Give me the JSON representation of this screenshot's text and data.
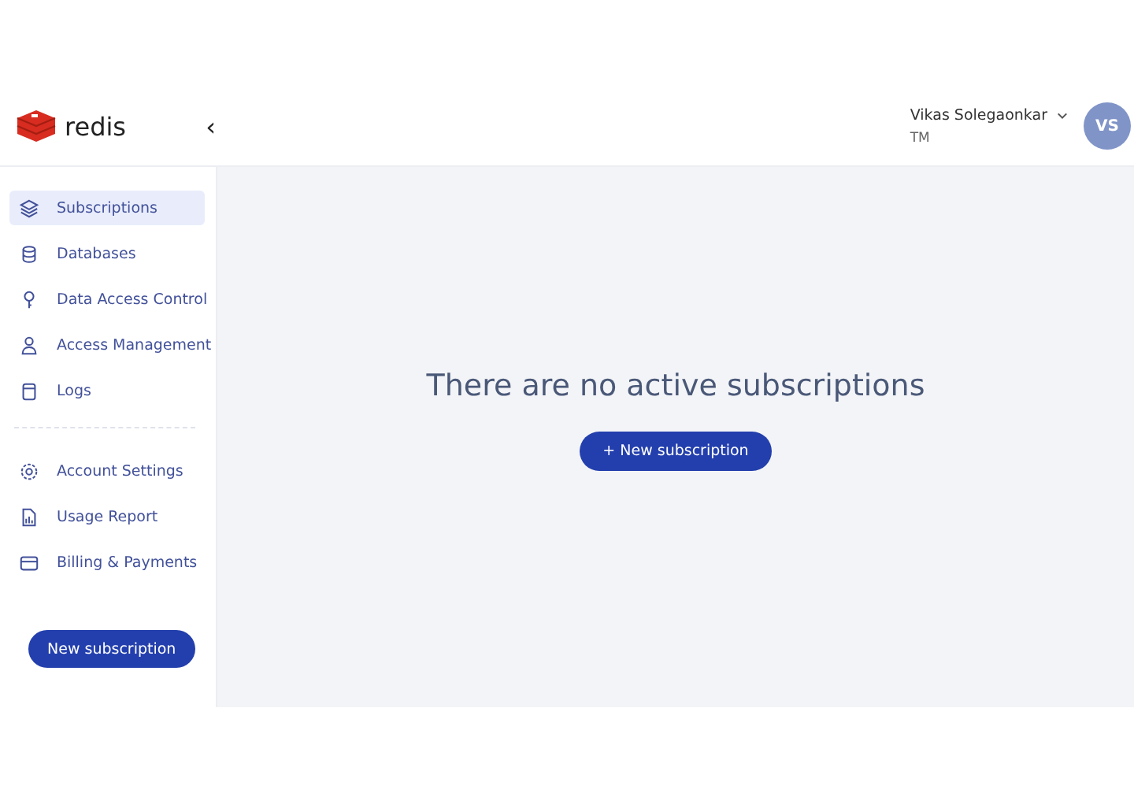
{
  "logo": {
    "text": "redis"
  },
  "collapse": {
    "glyph": "‹"
  },
  "user": {
    "name": "Vikas Solegaonkar",
    "org": "TM",
    "initials": "VS"
  },
  "sidebar": {
    "items": [
      {
        "label": "Subscriptions",
        "selected": true
      },
      {
        "label": "Databases",
        "selected": false
      },
      {
        "label": "Data Access Control",
        "selected": false
      },
      {
        "label": "Access Management",
        "selected": false
      },
      {
        "label": "Logs",
        "selected": false
      }
    ],
    "secondary_items": [
      {
        "label": "Account Settings",
        "selected": false
      },
      {
        "label": "Usage Report",
        "selected": false
      },
      {
        "label": "Billing & Payments",
        "selected": false
      }
    ],
    "button": "New subscription"
  },
  "main": {
    "message": "There are no active subscriptions",
    "button": "+ New subscription"
  }
}
